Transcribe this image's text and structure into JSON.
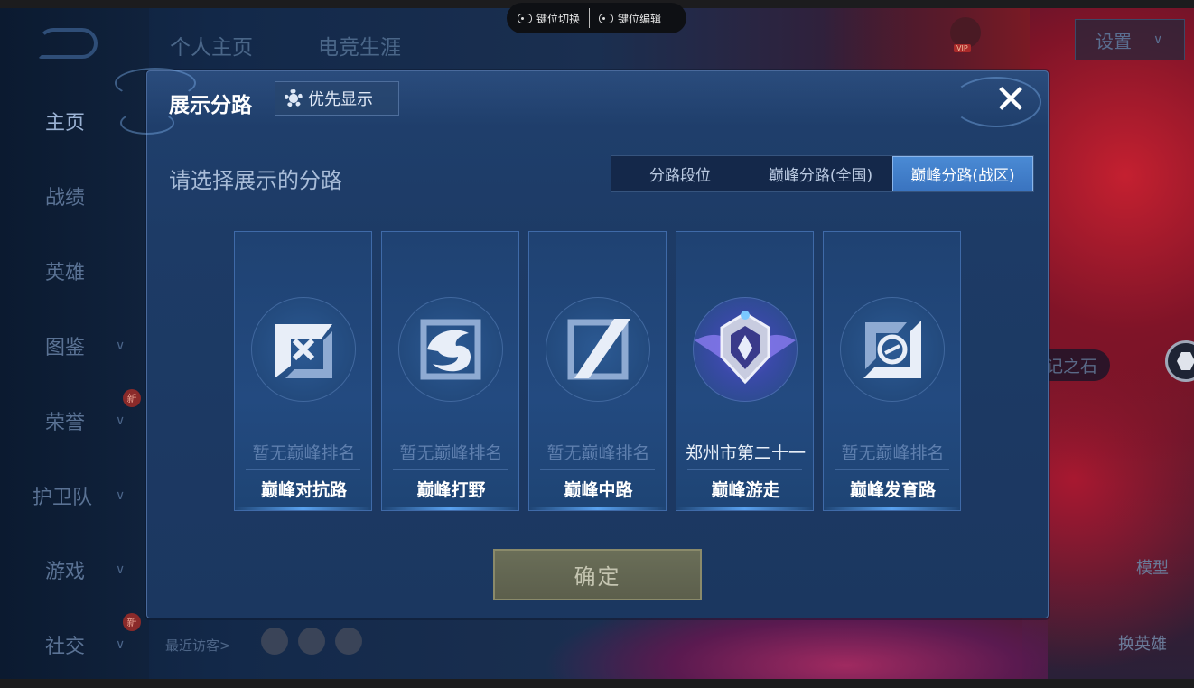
{
  "keybar": {
    "switch_label": "键位切换",
    "edit_label": "键位编辑"
  },
  "nav": {
    "items": [
      {
        "label": "主页",
        "active": true
      },
      {
        "label": "战绩"
      },
      {
        "label": "英雄"
      },
      {
        "label": "图鉴"
      },
      {
        "label": "荣誉",
        "badge": "新"
      },
      {
        "label": "护卫队"
      },
      {
        "label": "游戏"
      },
      {
        "label": "社交",
        "badge": "新"
      }
    ]
  },
  "top_tabs": [
    "个人主页",
    "电竞生涯"
  ],
  "settings_label": "设置",
  "background": {
    "stone_label": "记之石",
    "model_label": "模型",
    "swap_label": "换英雄",
    "visitors_label": "最近访客>"
  },
  "modal": {
    "title": "展示分路",
    "priority_button": "优先显示",
    "close_icon": "close-icon",
    "subtitle": "请选择展示的分路",
    "tabs": [
      {
        "label": "分路段位"
      },
      {
        "label": "巅峰分路(全国)"
      },
      {
        "label": "巅峰分路(战区)",
        "selected": true
      }
    ],
    "cards": [
      {
        "rank": "暂无巅峰排名",
        "lane": "巅峰对抗路",
        "icon": "clash-lane-icon"
      },
      {
        "rank": "暂无巅峰排名",
        "lane": "巅峰打野",
        "icon": "jungle-dragon-icon"
      },
      {
        "rank": "暂无巅峰排名",
        "lane": "巅峰中路",
        "icon": "mid-lane-icon"
      },
      {
        "rank": "郑州市第二十一",
        "lane": "巅峰游走",
        "icon": "roam-badge-icon"
      },
      {
        "rank": "暂无巅峰排名",
        "lane": "巅峰发育路",
        "icon": "farm-lane-icon"
      }
    ],
    "confirm_label": "确定"
  },
  "colors": {
    "accent": "#3a74c0",
    "modal_bg": "#1d3b66",
    "confirm_bg": "#5c5f4c"
  }
}
